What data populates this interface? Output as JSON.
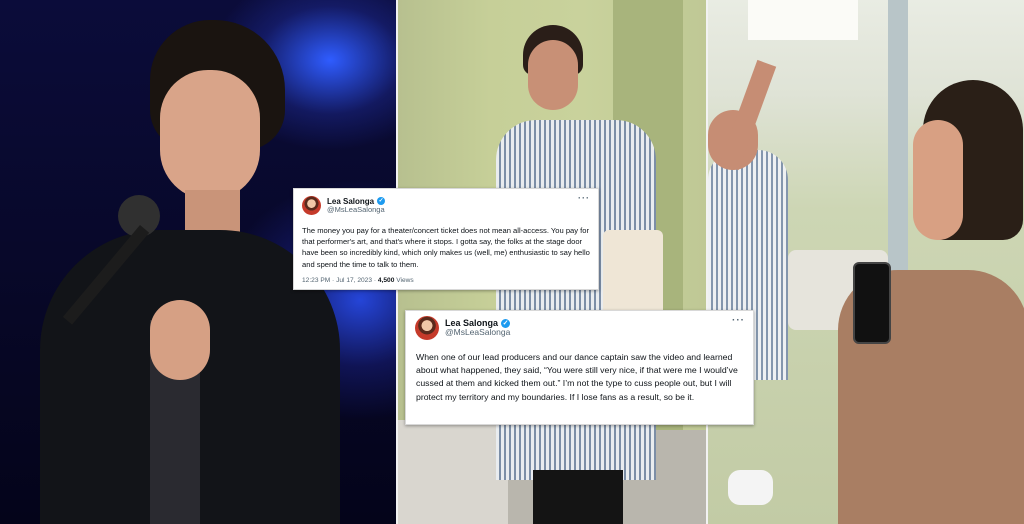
{
  "panels": {
    "left": "concert-photo",
    "middle": "hallway-photo",
    "right": "hallway-phone-photo"
  },
  "tweet_top": {
    "display_name": "Lea Salonga",
    "handle": "@MsLeaSalonga",
    "more": "···",
    "text": "The money you pay for a theater/concert ticket does not mean all-access. You pay for that performer's art, and that's where it stops. I gotta say, the folks at the stage door have been so incredibly kind, which only makes us (well, me) enthusiastic to say hello and spend the time to talk to them.",
    "timestamp": "12:23 PM · Jul 17, 2023 · ",
    "views_count": "4,500",
    "views_label": " Views"
  },
  "tweet_bottom": {
    "display_name": "Lea Salonga",
    "handle": "@MsLeaSalonga",
    "more": "···",
    "text": "When one of our lead producers and our dance captain saw the video and learned about what happened, they said, “You were still very nice, if that were me I would’ve cussed at them and kicked them out.” I’m not the type to cuss people out, but I will protect my territory and my boundaries. If I lose fans as a result, so be it."
  },
  "colors": {
    "verified": "#1d9bf0",
    "stage_blue": "#2545d8",
    "wall_green": "#c6cf98"
  }
}
